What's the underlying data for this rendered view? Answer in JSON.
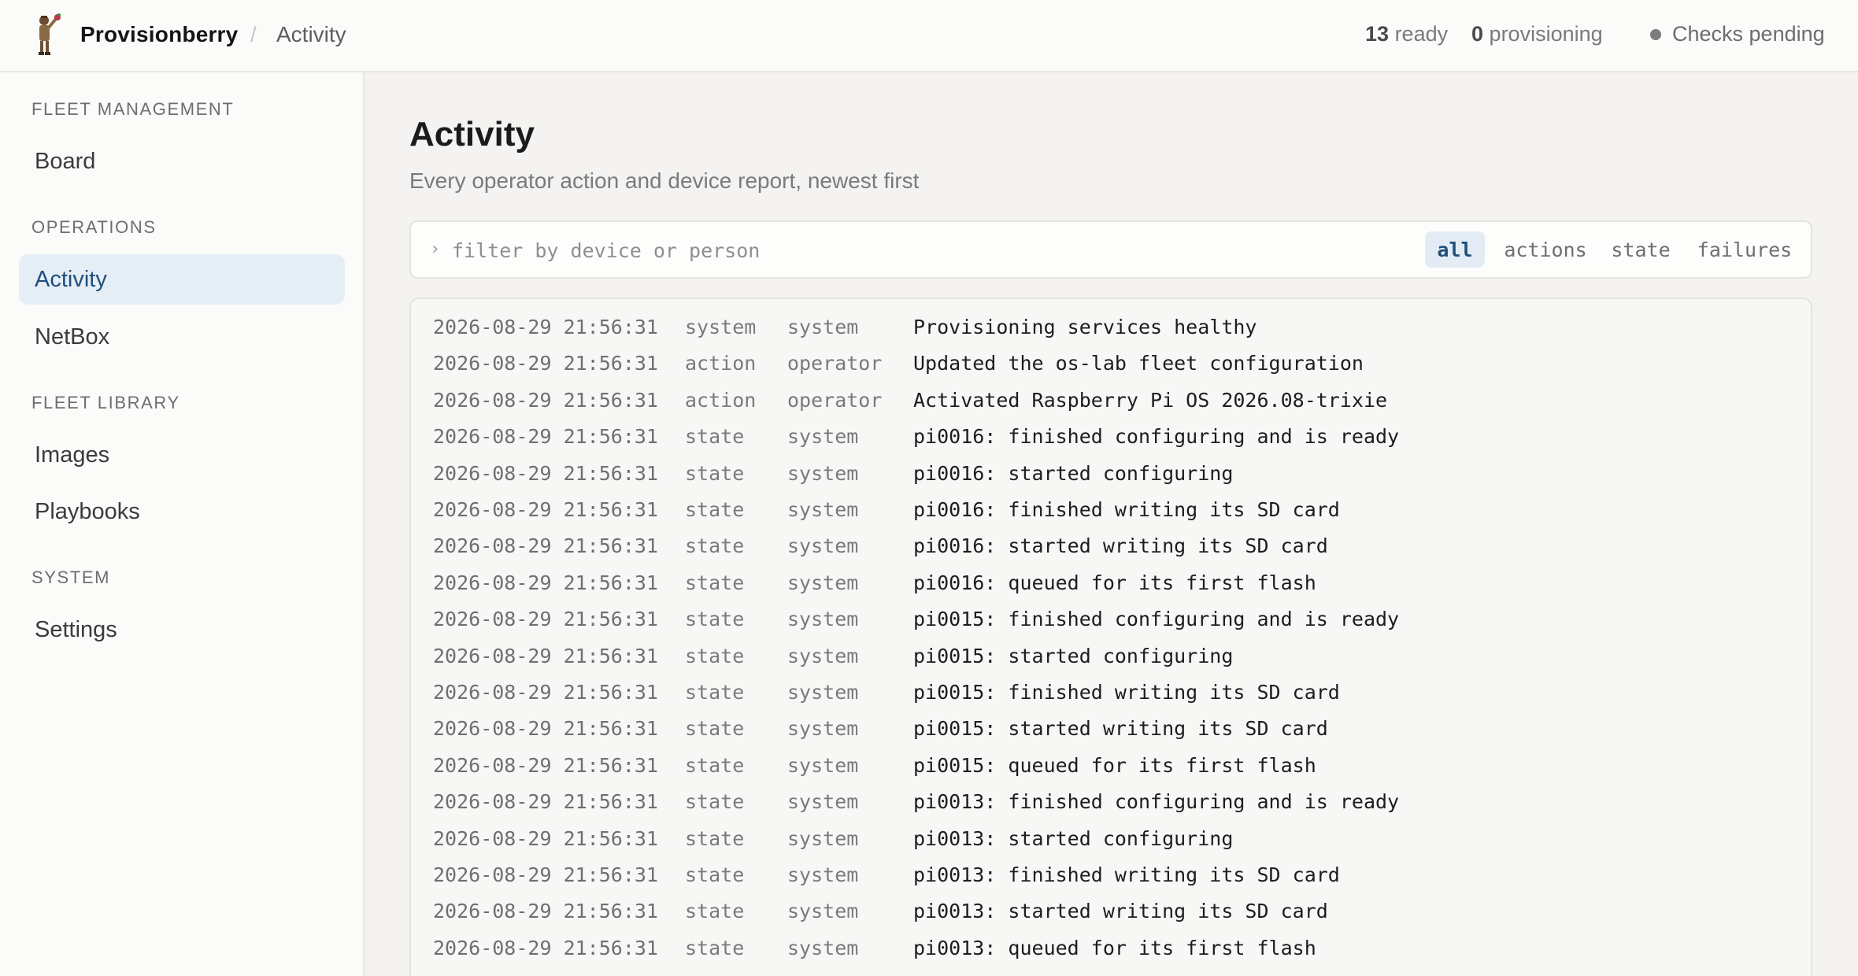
{
  "header": {
    "brand": "Provisionberry",
    "separator": "/",
    "crumb": "Activity",
    "ready_count": "13",
    "ready_label": "ready",
    "provisioning_count": "0",
    "provisioning_label": "provisioning",
    "checks": "Checks pending"
  },
  "sidebar": {
    "sections": [
      {
        "label": "FLEET MANAGEMENT",
        "items": [
          "Board"
        ]
      },
      {
        "label": "OPERATIONS",
        "items": [
          "Activity",
          "NetBox"
        ]
      },
      {
        "label": "FLEET LIBRARY",
        "items": [
          "Images",
          "Playbooks"
        ]
      },
      {
        "label": "SYSTEM",
        "items": [
          "Settings"
        ]
      }
    ],
    "active_item": "Activity"
  },
  "main": {
    "title": "Activity",
    "subtitle": "Every operator action and device report, newest first",
    "filter": {
      "prompt": "›",
      "placeholder": "filter by device or person",
      "chips": [
        "all",
        "actions",
        "state",
        "failures"
      ],
      "active_chip": "all"
    },
    "log": [
      {
        "ts": "2026-08-29 21:56:31",
        "kind": "system",
        "actor": "system",
        "msg": "Provisioning services healthy"
      },
      {
        "ts": "2026-08-29 21:56:31",
        "kind": "action",
        "actor": "operator",
        "msg": "Updated the os-lab fleet configuration"
      },
      {
        "ts": "2026-08-29 21:56:31",
        "kind": "action",
        "actor": "operator",
        "msg": "Activated Raspberry Pi OS 2026.08-trixie"
      },
      {
        "ts": "2026-08-29 21:56:31",
        "kind": "state",
        "actor": "system",
        "msg": "pi0016: finished configuring and is ready"
      },
      {
        "ts": "2026-08-29 21:56:31",
        "kind": "state",
        "actor": "system",
        "msg": "pi0016: started configuring"
      },
      {
        "ts": "2026-08-29 21:56:31",
        "kind": "state",
        "actor": "system",
        "msg": "pi0016: finished writing its SD card"
      },
      {
        "ts": "2026-08-29 21:56:31",
        "kind": "state",
        "actor": "system",
        "msg": "pi0016: started writing its SD card"
      },
      {
        "ts": "2026-08-29 21:56:31",
        "kind": "state",
        "actor": "system",
        "msg": "pi0016: queued for its first flash"
      },
      {
        "ts": "2026-08-29 21:56:31",
        "kind": "state",
        "actor": "system",
        "msg": "pi0015: finished configuring and is ready"
      },
      {
        "ts": "2026-08-29 21:56:31",
        "kind": "state",
        "actor": "system",
        "msg": "pi0015: started configuring"
      },
      {
        "ts": "2026-08-29 21:56:31",
        "kind": "state",
        "actor": "system",
        "msg": "pi0015: finished writing its SD card"
      },
      {
        "ts": "2026-08-29 21:56:31",
        "kind": "state",
        "actor": "system",
        "msg": "pi0015: started writing its SD card"
      },
      {
        "ts": "2026-08-29 21:56:31",
        "kind": "state",
        "actor": "system",
        "msg": "pi0015: queued for its first flash"
      },
      {
        "ts": "2026-08-29 21:56:31",
        "kind": "state",
        "actor": "system",
        "msg": "pi0013: finished configuring and is ready"
      },
      {
        "ts": "2026-08-29 21:56:31",
        "kind": "state",
        "actor": "system",
        "msg": "pi0013: started configuring"
      },
      {
        "ts": "2026-08-29 21:56:31",
        "kind": "state",
        "actor": "system",
        "msg": "pi0013: finished writing its SD card"
      },
      {
        "ts": "2026-08-29 21:56:31",
        "kind": "state",
        "actor": "system",
        "msg": "pi0013: started writing its SD card"
      },
      {
        "ts": "2026-08-29 21:56:31",
        "kind": "state",
        "actor": "system",
        "msg": "pi0013: queued for its first flash"
      }
    ]
  },
  "icons": {
    "logo": "raspberry-mascot-icon",
    "status_dot": "status-dot-icon"
  },
  "colors": {
    "accent": "#1f4f7c",
    "active_bg": "#e6eef5"
  }
}
